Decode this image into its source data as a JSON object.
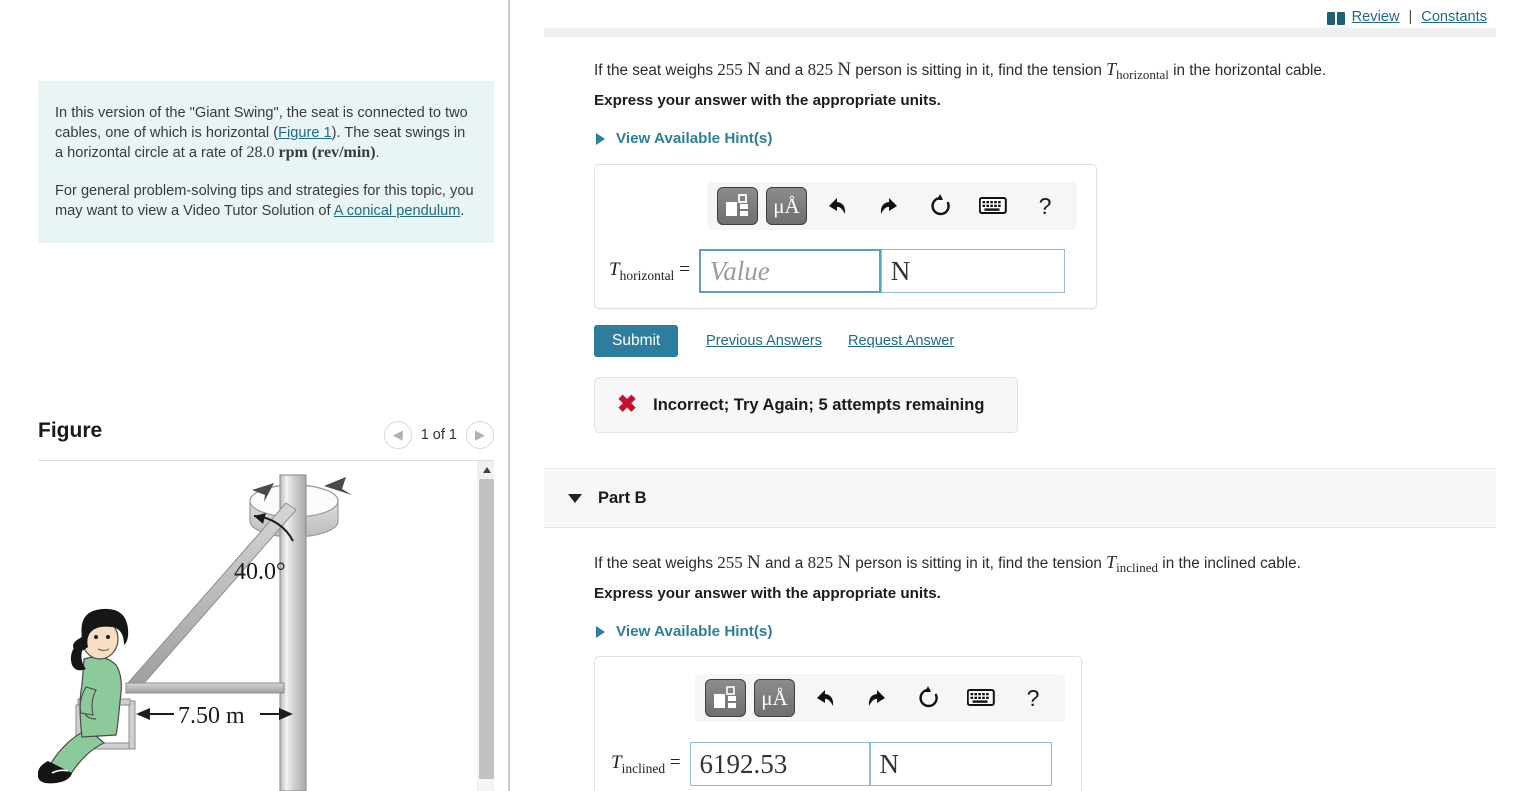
{
  "top": {
    "review_label": "Review",
    "separator": "|",
    "constants_label": "Constants",
    "book_icon": "book-icon"
  },
  "left": {
    "intro_p1_a": "In this version of the \"Giant Swing\", the seat is connected to two cables, one of which is horizontal (",
    "intro_p1_link": "Figure 1",
    "intro_p1_b": "). The seat swings in a horizontal circle at a rate of ",
    "intro_rate_value": "28.0",
    "intro_rate_unit": "rpm (rev/min)",
    "intro_p1_end": ".",
    "intro_p2_a": "For general problem-solving tips and strategies for this topic, you may want to view a Video Tutor Solution of ",
    "intro_p2_link": "A conical pendulum",
    "intro_p2_end": ".",
    "figure_title": "Figure",
    "figure_count": "1 of 1",
    "prev_icon": "chevron-left-icon",
    "next_icon": "chevron-right-icon",
    "figure": {
      "angle_label": "40.0°",
      "distance_label": "7.50 m"
    }
  },
  "partA": {
    "q_a": "If the seat weighs ",
    "q_w1": "255",
    "q_u1": "N",
    "q_b": " and a ",
    "q_w2": "825",
    "q_u2": "N",
    "q_c": " person is sitting in it, find the tension ",
    "q_var": "T",
    "q_sub": "horizontal",
    "q_d": " in the horizontal cable.",
    "express": "Express your answer with the appropriate units.",
    "hint_label": "View Available Hint(s)",
    "toolbar": {
      "template_icon": "math-template-icon",
      "units_icon": "micro-angstrom-units-icon",
      "undo_icon": "undo-icon",
      "redo_icon": "redo-icon",
      "reset_icon": "reset-icon",
      "keyboard_icon": "keyboard-icon",
      "help_icon": "help-question-icon"
    },
    "var_label": "T",
    "var_sub": "horizontal",
    "equals": "=",
    "value": "",
    "placeholder": "Value",
    "unit": "N",
    "submit_label": "Submit",
    "previous_answers_label": "Previous Answers",
    "request_answer_label": "Request Answer",
    "feedback_icon": "x-mark-icon",
    "feedback_text": "Incorrect; Try Again; 5 attempts remaining"
  },
  "partB": {
    "caret_icon": "caret-down-icon",
    "header_label": "Part B",
    "q_a": "If the seat weighs ",
    "q_w1": "255",
    "q_u1": "N",
    "q_b": " and a ",
    "q_w2": "825",
    "q_u2": "N",
    "q_c": " person is sitting in it, find the tension ",
    "q_var": "T",
    "q_sub": "inclined",
    "q_d": " in the inclined cable.",
    "express": "Express your answer with the appropriate units.",
    "hint_label": "View Available Hint(s)",
    "toolbar": {
      "template_icon": "math-template-icon",
      "units_icon": "micro-angstrom-units-icon",
      "undo_icon": "undo-icon",
      "redo_icon": "redo-icon",
      "reset_icon": "reset-icon",
      "keyboard_icon": "keyboard-icon",
      "help_icon": "help-question-icon"
    },
    "var_label": "T",
    "var_sub": "inclined",
    "equals": "=",
    "value": "6192.53",
    "unit": "N"
  },
  "colors": {
    "accent": "#2e7c9e",
    "link": "#1f6b85",
    "hint": "#2e7f99",
    "intro_bg": "#e9f5f5",
    "error": "#c8102e",
    "field_focus_border": "#5ba3b8"
  }
}
